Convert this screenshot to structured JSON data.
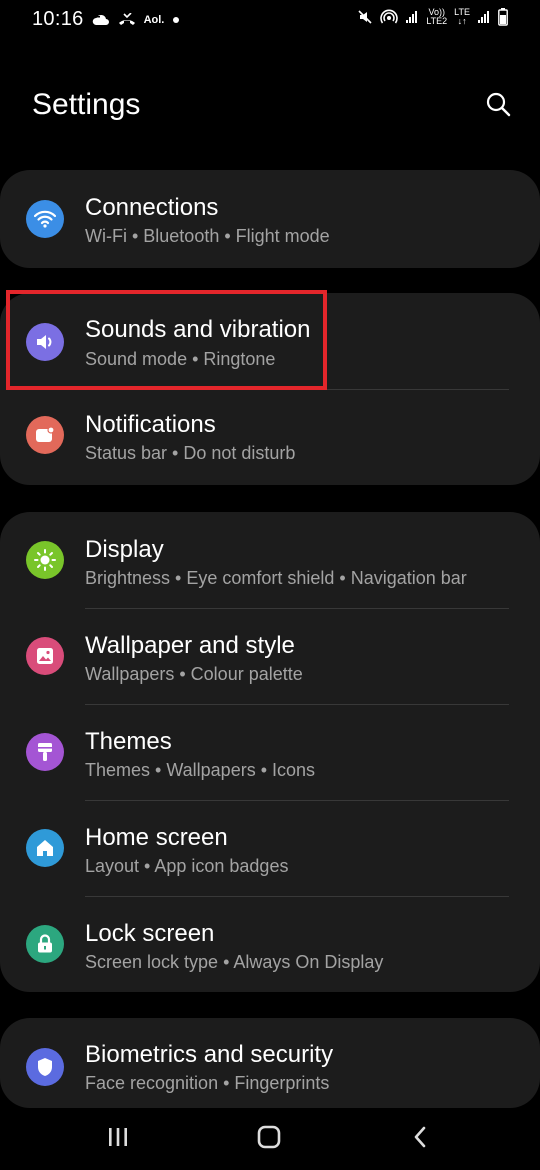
{
  "status_bar": {
    "time": "10:16",
    "carrier_label": "Aol.",
    "lte_top": "Vo))",
    "lte_bottom": "LTE2",
    "lte_right_top": "LTE",
    "lte_right_bottom": "↓↑",
    "icons_left": [
      "cloud-icon",
      "missed-call-icon",
      "aol-icon",
      "dot-icon"
    ],
    "icons_right": [
      "mute-icon",
      "hotspot-icon",
      "signal-icon",
      "volte-icon",
      "signal2-icon",
      "battery-icon"
    ]
  },
  "header": {
    "title": "Settings",
    "search_icon": "search-icon"
  },
  "groups": [
    {
      "items": [
        {
          "id": "connections",
          "title": "Connections",
          "subtitle": "Wi-Fi  •  Bluetooth  •  Flight mode",
          "icon": "wifi-icon",
          "color": "#3b8ee6"
        }
      ]
    },
    {
      "items": [
        {
          "id": "sounds",
          "title": "Sounds and vibration",
          "subtitle": "Sound mode  •  Ringtone",
          "icon": "speaker-icon",
          "color": "#7b6fe3"
        },
        {
          "id": "notifications",
          "title": "Notifications",
          "subtitle": "Status bar  •  Do not disturb",
          "icon": "notification-icon",
          "color": "#e2695a"
        }
      ]
    },
    {
      "items": [
        {
          "id": "display",
          "title": "Display",
          "subtitle": "Brightness  •  Eye comfort shield  •  Navigation bar",
          "icon": "sun-icon",
          "color": "#79c52a"
        },
        {
          "id": "wallpaper",
          "title": "Wallpaper and style",
          "subtitle": "Wallpapers  •  Colour palette",
          "icon": "image-icon",
          "color": "#d94c7a"
        },
        {
          "id": "themes",
          "title": "Themes",
          "subtitle": "Themes  •  Wallpapers  •  Icons",
          "icon": "paintbrush-icon",
          "color": "#a455d4"
        },
        {
          "id": "home",
          "title": "Home screen",
          "subtitle": "Layout  •  App icon badges",
          "icon": "home-icon",
          "color": "#2f9ad8"
        },
        {
          "id": "lock",
          "title": "Lock screen",
          "subtitle": "Screen lock type  •  Always On Display",
          "icon": "lock-icon",
          "color": "#2ca77f"
        }
      ]
    },
    {
      "items": [
        {
          "id": "biometrics",
          "title": "Biometrics and security",
          "subtitle": "Face recognition  •  Fingerprints",
          "icon": "shield-icon",
          "color": "#5b6be0"
        }
      ]
    }
  ],
  "nav_bar": {
    "recents": "recents-icon",
    "home": "home-nav-icon",
    "back": "back-icon"
  },
  "highlight_color": "#e3262b"
}
